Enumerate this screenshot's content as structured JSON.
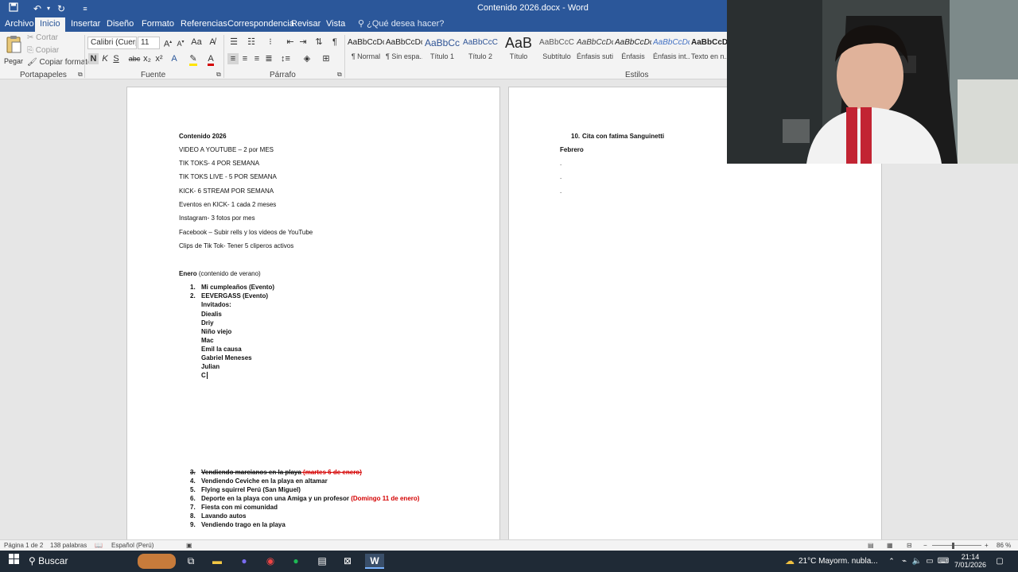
{
  "titlebar": {
    "title": "Contenido 2026.docx - Word",
    "icons": [
      "save-icon",
      "undo-icon",
      "redo-icon",
      "customize-icon"
    ]
  },
  "tabs": {
    "items": [
      "Archivo",
      "Inicio",
      "Insertar",
      "Diseño",
      "Formato",
      "Referencias",
      "Correspondencia",
      "Revisar",
      "Vista"
    ],
    "tellme": "¿Qué desea hacer?"
  },
  "ribbon": {
    "clipboard": {
      "paste": "Pegar",
      "cut": "Cortar",
      "copy": "Copiar",
      "format_painter": "Copiar formato",
      "label": "Portapapeles"
    },
    "font": {
      "name": "Calibri (Cuerpo",
      "size": "11",
      "bold": "N",
      "italic": "K",
      "underline": "S",
      "strike": "abc",
      "sub": "x₂",
      "sup": "x²",
      "label": "Fuente"
    },
    "paragraph": {
      "label": "Párrafo"
    },
    "styles": {
      "label": "Estilos",
      "items": [
        {
          "preview": "AaBbCcDc",
          "name": "¶ Normal"
        },
        {
          "preview": "AaBbCcDc",
          "name": "¶ Sin espa..."
        },
        {
          "preview": "AaBbCc",
          "name": "Título 1"
        },
        {
          "preview": "AaBbCcC",
          "name": "Título 2"
        },
        {
          "preview": "AaB",
          "name": "Título"
        },
        {
          "preview": "AaBbCcC",
          "name": "Subtítulo"
        },
        {
          "preview": "AaBbCcDc",
          "name": "Énfasis sutil"
        },
        {
          "preview": "AaBbCcDc",
          "name": "Énfasis"
        },
        {
          "preview": "AaBbCcDc",
          "name": "Énfasis int..."
        },
        {
          "preview": "AaBbCcDc",
          "name": "Texto en n..."
        }
      ]
    }
  },
  "page1": {
    "title": "Contenido 2026",
    "lines": [
      "VIDEO A YOUTUBE – 2 por MES",
      "TIK TOKS- 4 POR SEMANA",
      "TIK TOKS LIVE - 5 POR SEMANA",
      "KICK- 6 STREAM POR SEMANA",
      "Eventos en KICK-  1 cada 2 meses",
      "Instagram- 3 fotos por mes",
      "Facebook – Subir rells y los videos de YouTube",
      "Clips de Tik Tok- Tener 5 cliperos activos"
    ],
    "month_heading": "Enero",
    "month_note": " (contenido de verano)",
    "list_top": [
      {
        "n": "1.",
        "text": "Mi cumpleaños (Evento)"
      },
      {
        "n": "2.",
        "text": "EEVERGASS (Evento)"
      }
    ],
    "invitados_label": "Invitados:",
    "guests": [
      "Diealis",
      "Driy",
      "Niño viejo",
      "Mac",
      "Emil la causa",
      "Gabriel Meneses",
      "Julian",
      "C"
    ],
    "list_bottom": [
      {
        "n": "3.",
        "text": "Vendiendo marcianos en la playa",
        "extra": " (martes 6 de enero)"
      },
      {
        "n": "4.",
        "text": "Vendiendo Ceviche en la playa en altamar",
        "extra": ""
      },
      {
        "n": "5.",
        "text": "Flying squirrel Perú (San Miguel)",
        "extra": ""
      },
      {
        "n": "6.",
        "text": "Deporte en la playa con una Amiga y un profesor",
        "extra": " (Domingo 11 de enero)"
      },
      {
        "n": "7.",
        "text": "Fiesta con mi comunidad",
        "extra": ""
      },
      {
        "n": "8.",
        "text": "Lavando autos",
        "extra": ""
      },
      {
        "n": "9.",
        "text": "Vendiendo trago en la playa",
        "extra": ""
      }
    ]
  },
  "page2": {
    "item10": {
      "n": "10.",
      "text": "Cita con fatima Sanguinetti"
    },
    "month_heading": "Febrero",
    "dots": [
      ".",
      ".",
      "."
    ]
  },
  "statusbar": {
    "page": "Página 1 de 2",
    "words": "138 palabras",
    "language": "Español (Perú)",
    "zoom": "86 %",
    "zoom_value": 86
  },
  "taskbar": {
    "search": "Buscar",
    "weather": "21°C  Mayorm. nubla...",
    "time": "21:14",
    "date": "7/01/2026"
  },
  "colors": {
    "word_blue": "#2b579a",
    "red": "#d40000"
  }
}
